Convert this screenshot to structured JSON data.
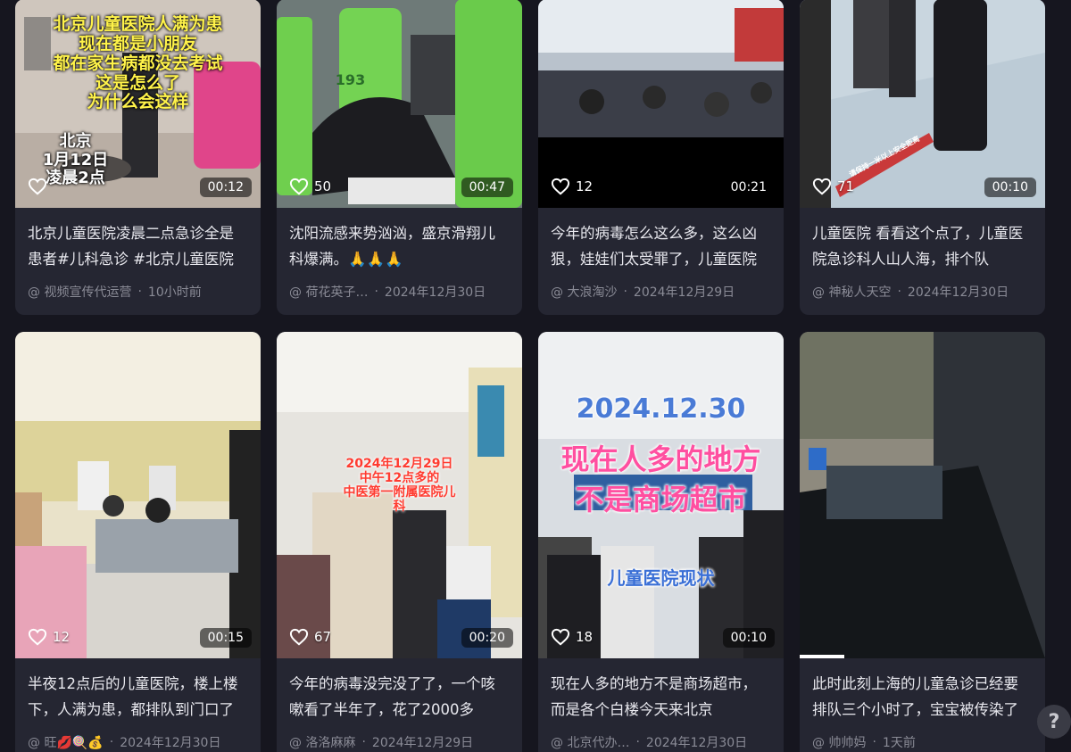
{
  "videos": [
    {
      "likes": "",
      "duration": "00:12",
      "title": "北京儿童医院凌晨二点急诊全是患者#儿科急诊 #北京儿童医院",
      "author": "@ 视频宣传代运营",
      "time": "10小时前",
      "overlay_lines": [
        "北京儿童医院人满为患",
        "现在都是小朋友",
        "都在家生病都没去考试",
        "这是怎么了",
        "为什么会这样",
        "北京",
        "1月12日",
        "凌晨2点"
      ]
    },
    {
      "likes": "50",
      "duration": "00:47",
      "title": "沈阳流感来势汹汹，盛京滑翔儿科爆满。🙏🙏🙏",
      "author": "@ 荷花英子…",
      "time": "2024年12月30日",
      "overlay_lines": [
        "193"
      ]
    },
    {
      "likes": "12",
      "duration": "00:21",
      "title": "今年的病毒怎么这么多，这么凶狠，娃娃们太受罪了，儿童医院",
      "author": "@ 大浪淘沙",
      "time": "2024年12月29日",
      "overlay_lines": []
    },
    {
      "likes": "71",
      "duration": "00:10",
      "title": "儿童医院 看看这个点了，儿童医院急诊科人山人海，排个队",
      "author": "@ 神秘人天空",
      "time": "2024年12月30日",
      "overlay_lines": [
        "请保持一米以上安全距离"
      ]
    },
    {
      "likes": "12",
      "duration": "00:15",
      "title": "半夜12点后的儿童医院，楼上楼下，人满为患，都排队到门口了",
      "author": "@ 旺💋🍭💰",
      "time": "2024年12月30日",
      "overlay_lines": []
    },
    {
      "likes": "67",
      "duration": "00:20",
      "title": "今年的病毒没完没了了，一个咳嗽看了半年了，花了2000多",
      "author": "@ 洛洛麻麻",
      "time": "2024年12月29日",
      "overlay_lines": [
        "2024年12月29日",
        "中午12点多的",
        "中医第一附属医院儿",
        "科"
      ]
    },
    {
      "likes": "18",
      "duration": "00:10",
      "title": "现在人多的地方不是商场超市，而是各个白楼今天来北京",
      "author": "@ 北京代办…",
      "time": "2024年12月30日",
      "overlay_lines": [
        "2024.12.30",
        "现在人多的地方",
        "不是商场超市",
        "儿童医院现状"
      ]
    },
    {
      "likes": "",
      "duration": "",
      "title": "此时此刻上海的儿童急诊已经要排队三个小时了，宝宝被传染了",
      "author": "@ 帅帅妈",
      "time": "1天前",
      "overlay_lines": []
    }
  ],
  "help_label": "?",
  "icons": {
    "like": "heart-outline-icon",
    "help": "help-icon"
  }
}
